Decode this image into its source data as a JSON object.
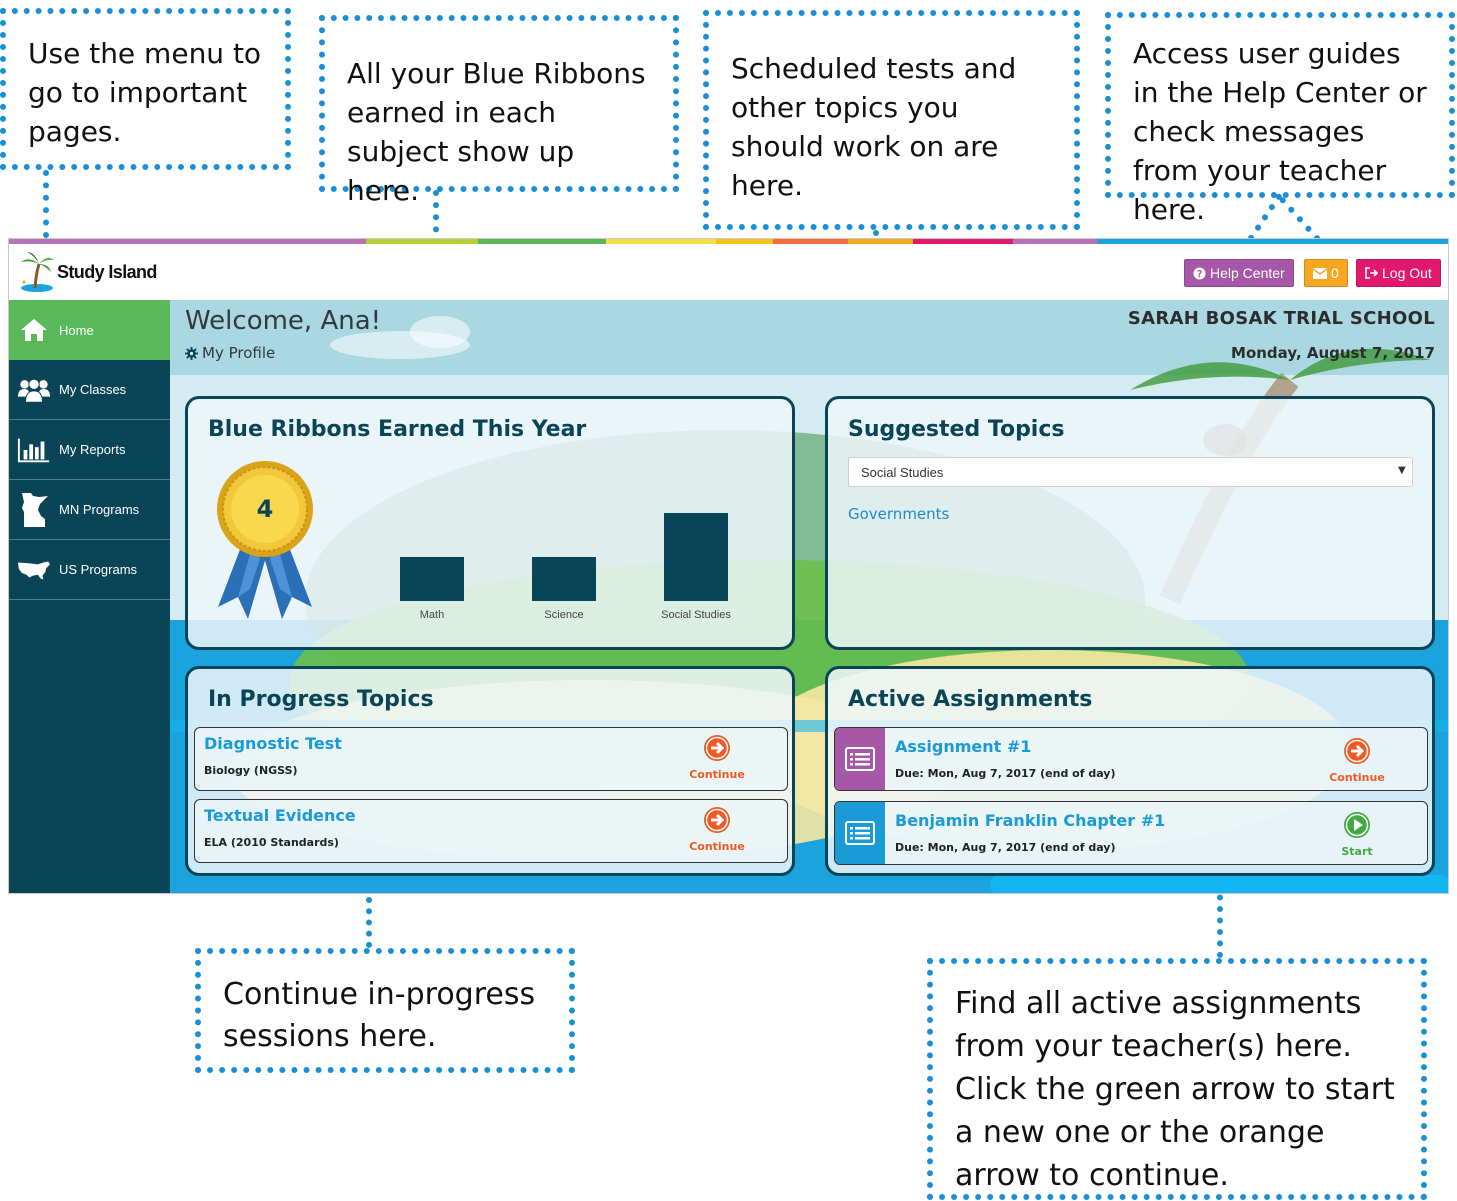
{
  "callouts": {
    "menu": "Use the menu to go to important pages.",
    "ribbons": "All your Blue Ribbons earned in each subject show up here.",
    "scheduled": "Scheduled tests and other topics you should work on are here.",
    "help": "Access user guides in the Help Center or check messages from your teacher here.",
    "progress": "Continue in-progress sessions here.",
    "assignments": "Find all active assignments from your teacher(s) here. Click the green arrow to start a new one or the orange arrow to continue."
  },
  "header": {
    "brand": "Study Island",
    "help_center": "Help Center",
    "messages_count": "0",
    "logout": "Log Out"
  },
  "sidebar": {
    "items": [
      {
        "label": "Home",
        "icon": "home-icon"
      },
      {
        "label": "My Classes",
        "icon": "users-icon"
      },
      {
        "label": "My Reports",
        "icon": "bar-chart-icon"
      },
      {
        "label": "MN Programs",
        "icon": "minnesota-map-icon"
      },
      {
        "label": "US Programs",
        "icon": "us-map-icon"
      }
    ]
  },
  "main": {
    "welcome": "Welcome, Ana!",
    "my_profile": "My Profile",
    "school": "SARAH BOSAK TRIAL SCHOOL",
    "date": "Monday, August 7, 2017"
  },
  "ribbons": {
    "title": "Blue Ribbons Earned This Year",
    "total": "4"
  },
  "chart_data": {
    "type": "bar",
    "categories": [
      "Math",
      "Science",
      "Social Studies"
    ],
    "values": [
      1,
      1,
      2
    ]
  },
  "suggested": {
    "title": "Suggested Topics",
    "selected_subject": "Social Studies",
    "topic": "Governments"
  },
  "in_progress": {
    "title": "In Progress Topics",
    "items": [
      {
        "title": "Diagnostic Test",
        "subtitle": "Biology (NGSS)",
        "action": "Continue"
      },
      {
        "title": "Textual Evidence",
        "subtitle": "ELA (2010 Standards)",
        "action": "Continue"
      }
    ]
  },
  "assignments": {
    "title": "Active Assignments",
    "items": [
      {
        "title": "Assignment #1",
        "due": "Due: Mon, Aug 7, 2017 (end of day)",
        "action": "Continue"
      },
      {
        "title": "Benjamin Franklin Chapter #1",
        "due": "Due: Mon, Aug 7, 2017 (end of day)",
        "action": "Start"
      }
    ]
  },
  "colors": {
    "navy": "#0a4457",
    "accent_blue": "#1a9ad6",
    "home_green": "#59b95a",
    "help_purple": "#a757a8",
    "messages_orange": "#f5a623",
    "logout_pink": "#e2186c",
    "continue_orange": "#ef5a24",
    "start_green": "#43a944",
    "callout_border": "#1a8fd6"
  }
}
